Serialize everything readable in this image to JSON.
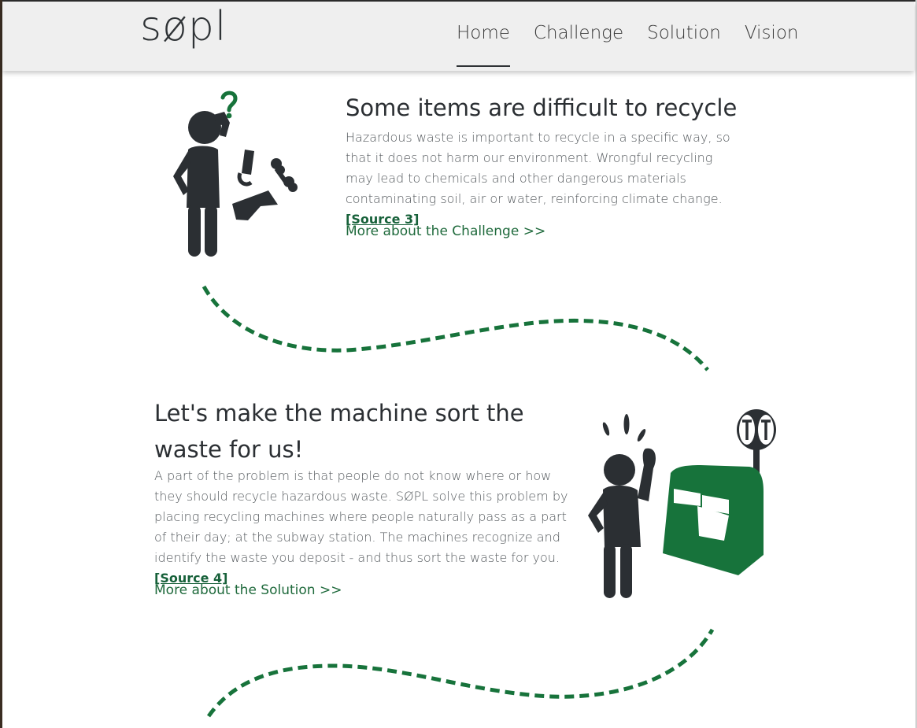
{
  "brand": {
    "logo_text": "søpl"
  },
  "nav": {
    "items": [
      {
        "label": "Home",
        "active": true
      },
      {
        "label": "Challenge",
        "active": false
      },
      {
        "label": "Solution",
        "active": false
      },
      {
        "label": "Vision",
        "active": false
      }
    ]
  },
  "sections": [
    {
      "heading": "Some items are difficult to recycle",
      "body": "Hazardous waste is important to recycle in a specific way, so that it does not harm our environment. Wrongful recycling may lead to chemicals and other dangerous materials contaminating soil, air or water, reinforcing climate change.",
      "source_label": "[Source 3]",
      "more_link": "More about the Challenge >>",
      "illustration_icon": "confused-person-hazardous-waste-icon"
    },
    {
      "heading": "Let's make the machine sort the waste for us!",
      "body": "A part of the problem is that people do not know where or how they should recycle hazardous waste. SØPL solve this problem by placing recycling machines where people naturally pass as a part of their day; at the subway station. The machines recognize and identify the waste you deposit - and thus sort the waste for you.",
      "source_label": "[Source 4]",
      "more_link": "More about the Solution >>",
      "illustration_icon": "person-at-recycling-machine-icon"
    }
  ],
  "colors": {
    "accent_green": "#17733b",
    "dark_figure": "#2b2f33",
    "nav_background": "#efefef"
  }
}
